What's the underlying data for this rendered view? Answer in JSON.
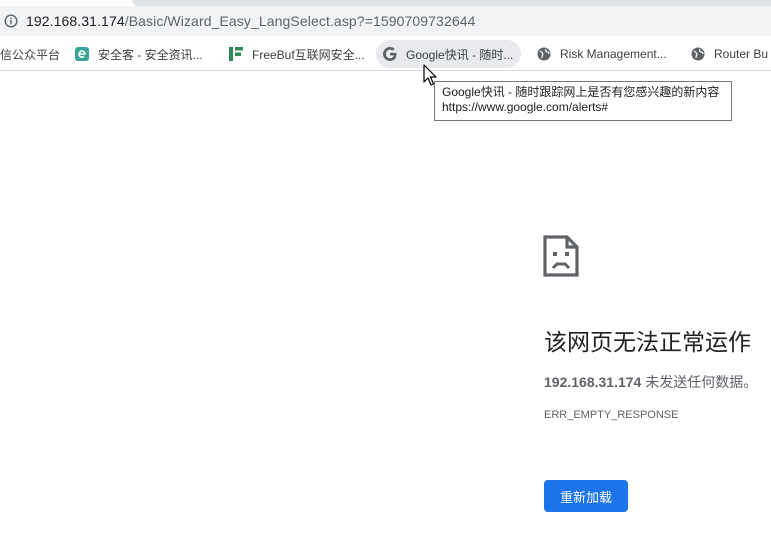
{
  "address_bar": {
    "url_host": "192.168.31.174",
    "url_path": "/Basic/Wizard_Easy_LangSelect.asp?=1590709732644"
  },
  "bookmarks": [
    {
      "label": "信公众平台",
      "icon": "none"
    },
    {
      "label": "安全客 - 安全资讯...",
      "icon": "anquanke-favicon"
    },
    {
      "label": "FreeBuf互联网安全...",
      "icon": "freebuf-favicon"
    },
    {
      "label": "Google快讯 - 随时...",
      "icon": "google-favicon"
    },
    {
      "label": "Risk Management...",
      "icon": "globe-icon"
    },
    {
      "label": "Router Bu",
      "icon": "globe-icon"
    }
  ],
  "tooltip": {
    "title": "Google快讯 - 随时跟踪网上是否有您感兴趣的新内容",
    "url": "https://www.google.com/alerts#"
  },
  "error": {
    "title": "该网页无法正常运作",
    "host": "192.168.31.174",
    "message": " 未发送任何数据。",
    "code": "ERR_EMPTY_RESPONSE",
    "reload_label": "重新加载"
  },
  "colors": {
    "accent": "#1a73e8",
    "address_bar_bg": "#f1f3f4",
    "text_secondary": "#5f6368"
  }
}
